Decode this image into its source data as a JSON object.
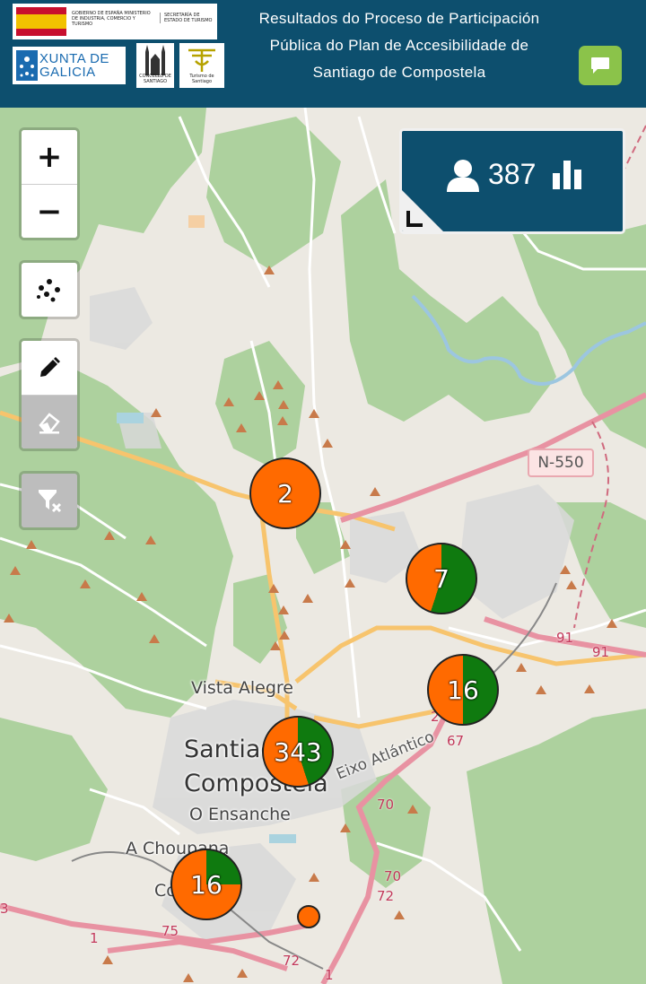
{
  "header": {
    "title": "Resultados do Proceso de Participación Pública do Plan de Accesibilidade de Santiago de Compostela",
    "logo_gobierno_text": "GOBIERNO DE ESPAÑA MINISTERIO DE INDUSTRIA, COMERCIO Y TURISMO",
    "logo_secretaria_text": "SECRETARÍA DE ESTADO DE TURISMO",
    "logo_xunta_text": "XUNTA DE GALICIA",
    "logo_concello_text": "CONCELLO DE SANTIAGO",
    "logo_turismo_text": "Turismo de Santiago"
  },
  "controls": {
    "zoom_in": "+",
    "zoom_out": "−"
  },
  "stats": {
    "participants": "387"
  },
  "map_labels": {
    "vista_alegre": "Vista Alegre",
    "santiago_1": "Santiago",
    "santiago_2": "Compostela",
    "ensanche": "O Ensanche",
    "choupana": "A Choupana",
    "eixo": "Eixo Atlántico",
    "n550": "N-550",
    "r91a": "91",
    "r91b": "91",
    "r67": "67",
    "r70a": "70",
    "r70b": "70",
    "r72a": "72",
    "r72b": "72",
    "r75": "75",
    "r1a": "1",
    "r1b": "1",
    "r3": "3",
    "r2": "2",
    "co": "Co"
  },
  "clusters": [
    {
      "count": "2",
      "green_fraction": 0
    },
    {
      "count": "7",
      "green_fraction": 0.55
    },
    {
      "count": "16",
      "green_fraction": 0.5
    },
    {
      "count": "343",
      "green_fraction": 0.45
    },
    {
      "count": "16",
      "green_fraction": 0.25
    }
  ],
  "colors": {
    "header_bg": "#0d4f6e",
    "chat_button": "#8bc34a",
    "cluster_orange": "#ff6a00",
    "cluster_green": "#0f7a0f",
    "forest": "#add19e",
    "road_major": "#f7c46d",
    "road_trunk": "#e892a2"
  },
  "icons": {
    "chat": "chat-bubble-icon",
    "cluster_toggle": "dots-cluster-icon",
    "draw": "pencil-icon",
    "erase": "eraser-icon",
    "clear_filter": "filter-clear-icon",
    "user": "user-icon",
    "chart": "bar-chart-icon"
  }
}
